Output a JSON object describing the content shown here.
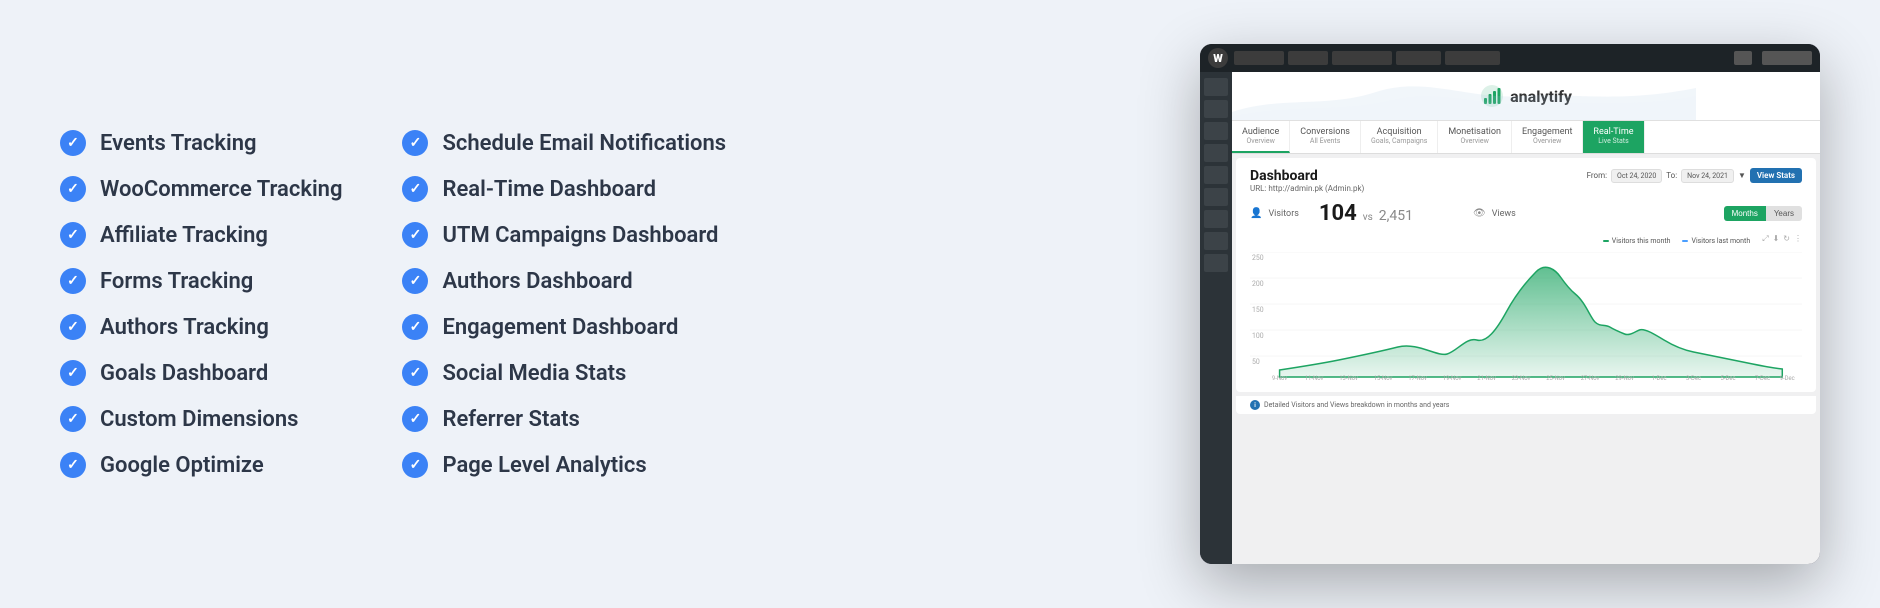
{
  "background": "#eef2f8",
  "features": {
    "left_column": [
      "Events Tracking",
      "WooCommerce Tracking",
      "Affiliate Tracking",
      "Forms Tracking",
      "Authors Tracking",
      "Goals Dashboard",
      "Custom Dimensions",
      "Google Optimize"
    ],
    "right_column": [
      "Schedule Email Notifications",
      "Real-Time Dashboard",
      "UTM Campaigns Dashboard",
      "Authors Dashboard",
      "Engagement Dashboard",
      "Social Media Stats",
      "Referrer Stats",
      "Page Level Analytics"
    ]
  },
  "dashboard": {
    "title": "Dashboard",
    "url_label": "URL: http://admin.pk (Admin.pk)",
    "from_label": "From:",
    "from_date": "Oct 24, 2020",
    "to_label": "To:",
    "to_date": "Nov 24, 2021",
    "view_stats": "View Stats",
    "visitors_label": "Visitors",
    "views_label": "Views",
    "big_number": "104",
    "vs_label": "vs",
    "compare_number": "2,451",
    "month_btn": "Months",
    "year_btn": "Years",
    "tabs": [
      {
        "label": "Audience",
        "sub": "Overview"
      },
      {
        "label": "Conversions",
        "sub": "All Events"
      },
      {
        "label": "Acquisition",
        "sub": "Goals, Campaigns"
      },
      {
        "label": "Monetisation",
        "sub": "Overview"
      },
      {
        "label": "Engagement",
        "sub": "Overview"
      },
      {
        "label": "Real-Time",
        "sub": "Live Stats"
      }
    ],
    "legend_this_month": "Visitors this month",
    "legend_last_month": "Visitors last month",
    "footer_text": "Detailed Visitors and Views breakdown in months and years",
    "logo_text": "analytify",
    "x_labels": [
      "9-Nov",
      "11-Nov",
      "13-Nov",
      "15-Nov",
      "17-Nov",
      "19-Nov",
      "21-Nov",
      "23-Nov",
      "25-Nov",
      "27-Nov",
      "29-Nov",
      "1-Dec",
      "3-Dec",
      "5-Dec",
      "7-Dec",
      "9-Dec"
    ]
  }
}
